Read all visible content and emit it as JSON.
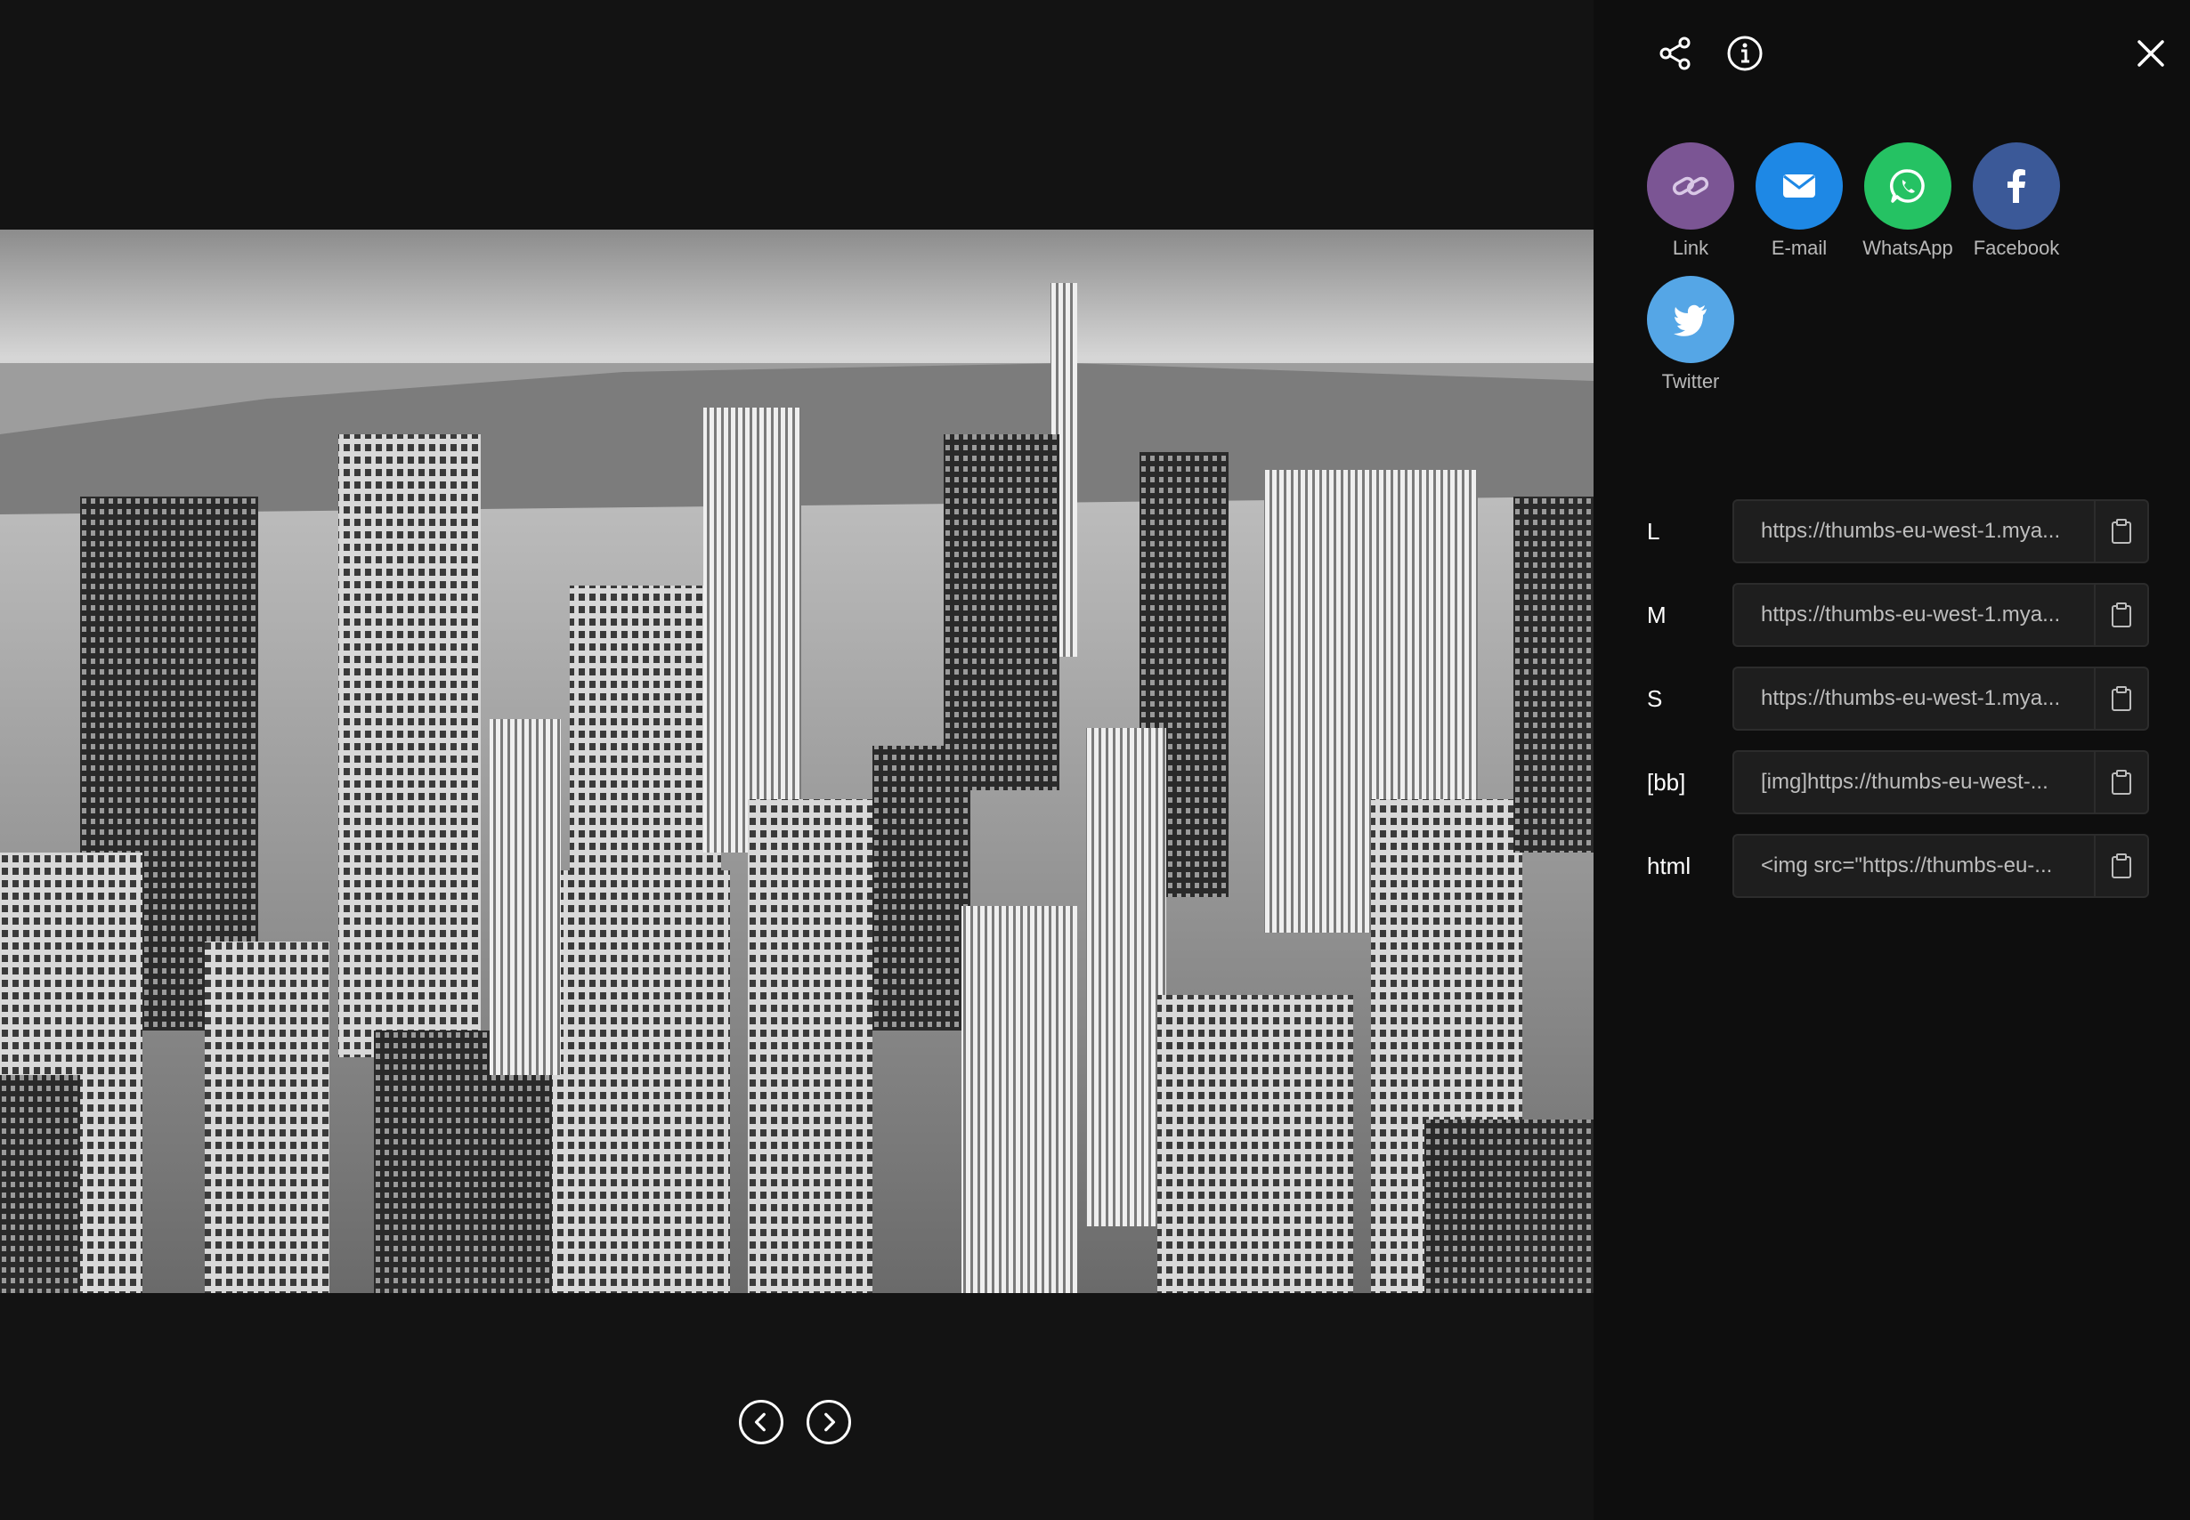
{
  "viewer": {
    "photo_alt": "Black and white aerial view of a city skyline",
    "prev_icon": "chevron-left-icon",
    "next_icon": "chevron-right-icon"
  },
  "panel": {
    "top_icons": [
      "share-icon",
      "info-icon",
      "close-icon"
    ],
    "share_targets": [
      {
        "label": "Link",
        "icon": "link-icon",
        "color": "#7b5594"
      },
      {
        "label": "E-mail",
        "icon": "envelope-icon",
        "color": "#1e88e5"
      },
      {
        "label": "WhatsApp",
        "icon": "whatsapp-icon",
        "color": "#25c263"
      },
      {
        "label": "Facebook",
        "icon": "facebook-icon",
        "color": "#3b5998"
      },
      {
        "label": "Twitter",
        "icon": "twitter-icon",
        "color": "#55a6e6"
      }
    ],
    "embed_rows": [
      {
        "label": "L",
        "value": "https://thumbs-eu-west-1.mya..."
      },
      {
        "label": "M",
        "value": "https://thumbs-eu-west-1.mya..."
      },
      {
        "label": "S",
        "value": "https://thumbs-eu-west-1.mya..."
      },
      {
        "label": "[bb]",
        "value": "[img]https://thumbs-eu-west-..."
      },
      {
        "label": "html",
        "value": "<img src=\"https://thumbs-eu-..."
      }
    ],
    "copy_icon": "clipboard-icon"
  }
}
